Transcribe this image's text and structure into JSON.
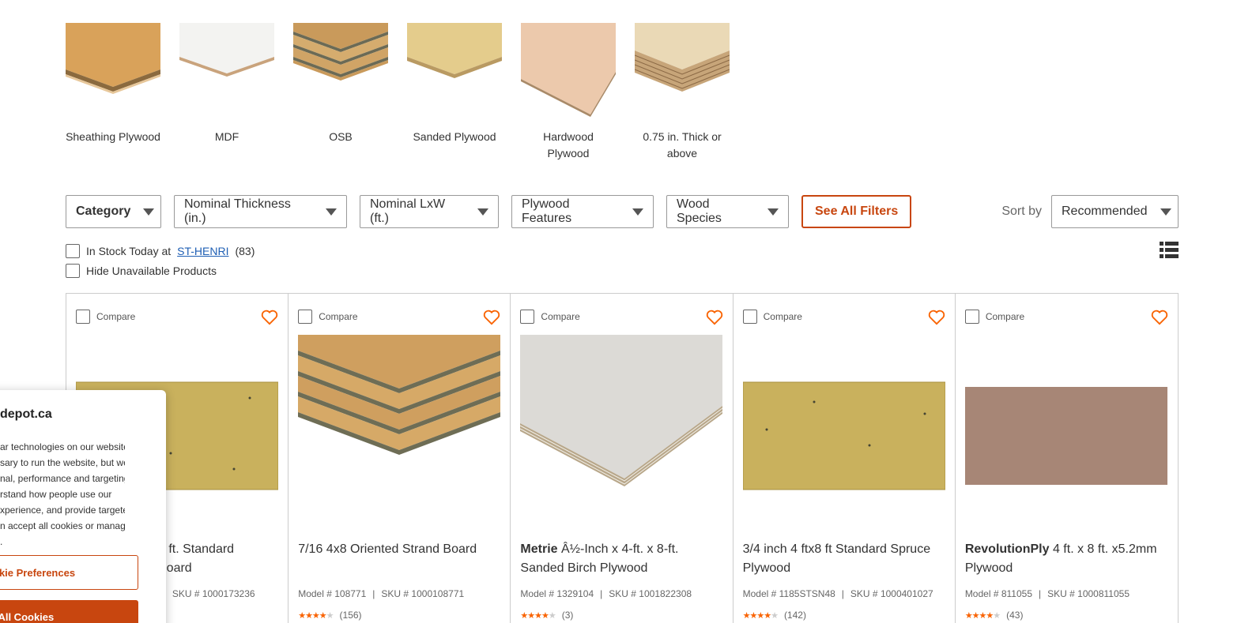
{
  "tiles": [
    {
      "label": "Sheathing Plywood"
    },
    {
      "label": "MDF"
    },
    {
      "label": "OSB"
    },
    {
      "label": "Sanded Plywood"
    },
    {
      "label": "Hardwood Plywood"
    },
    {
      "label": "0.75 in. Thick or above"
    }
  ],
  "filters": {
    "category": "Category",
    "thickness": "Nominal Thickness (in.)",
    "lxw": "Nominal LxW (ft.)",
    "features": "Plywood Features",
    "species": "Wood Species",
    "see_all": "See All Filters"
  },
  "sort": {
    "label": "Sort by",
    "value": "Recommended"
  },
  "availability": {
    "in_stock_prefix": "In Stock Today at",
    "store": "ST-HENRI",
    "count": "(83)",
    "hide_unavailable": "Hide Unavailable Products"
  },
  "compare_label": "Compare",
  "products": [
    {
      "brand": "",
      "title": "8 ft. Standard Board",
      "title_line1": "8 ft. Standard",
      "title_line2": "Board",
      "model_label": "8",
      "sku": "SKU # 1000173236",
      "rating": 3.5,
      "reviews": ""
    },
    {
      "brand": "",
      "title": "7/16 4x8 Oriented Strand Board",
      "model": "Model # 108771",
      "sku": "SKU # 1000108771",
      "rating": 3.5,
      "reviews": "(156)"
    },
    {
      "brand": "Metrie",
      "title": "Â½-Inch x 4-ft. x 8-ft. Sanded Birch Plywood",
      "model": "Model # 1329104",
      "sku": "SKU # 1001822308",
      "rating": 4,
      "reviews": "(3)"
    },
    {
      "brand": "",
      "title": "3/4 inch 4 ftx8 ft Standard Spruce Plywood",
      "model": "Model # 1185STSN48",
      "sku": "SKU # 1000401027",
      "rating": 3.5,
      "reviews": "(142)"
    },
    {
      "brand": "RevolutionPly",
      "title": "4 ft. x 8 ft. x5.2mm Plywood",
      "model": "Model # 811055",
      "sku": "SKU # 1000811055",
      "rating": 4.5,
      "reviews": "(43)"
    }
  ],
  "cookie": {
    "title": "depot.ca",
    "body": "ar technologies on our website.\nsary to run the website, but we\nnal, performance and targeting\nrstand how people use our\nxperience, and provide targeted\nn accept all cookies or manage\n.",
    "preferences_btn": "okie Preferences",
    "accept_btn": "t All Cookies"
  },
  "colors": {
    "accent": "#c8460f",
    "star": "#f96302",
    "link": "#1f5fb4"
  }
}
